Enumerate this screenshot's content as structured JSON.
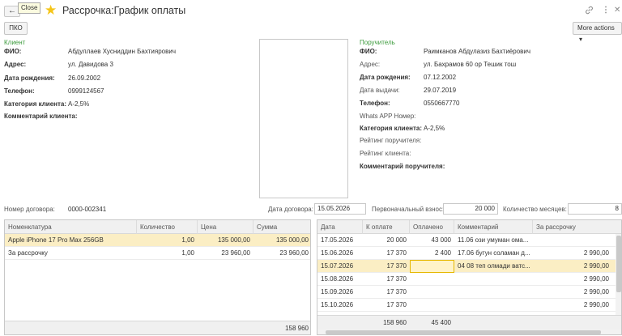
{
  "window": {
    "title": "Рассрочка:График оплаты",
    "tooltip": "Close"
  },
  "toolbar": {
    "pko_label": "ПКО",
    "more_actions_label": "More actions",
    "more_actions_arrow": "▾"
  },
  "client": {
    "section_label": "Клиент",
    "fio_label": "ФИО:",
    "fio": "Абдуллаев Хусниддин Бахтиярович",
    "address_label": "Адрес:",
    "address": "ул. Давидова 3",
    "birth_label": "Дата рождения:",
    "birth": "26.09.2002",
    "phone_label": "Телефон:",
    "phone": "0999124567",
    "category_label": "Категория клиента:",
    "category": "А-2,5%",
    "comment_label": "Комментарий клиента:"
  },
  "guarantor": {
    "section_label": "Поручитель",
    "fio_label": "ФИО:",
    "fio": "Раимканов Абдулазиз Бахтиёрович",
    "address_label": "Адрес:",
    "address": "ул. Бахрамов 60 ор Тешик тош",
    "birth_label": "Дата рождения:",
    "birth": "07.12.2002",
    "issue_label": "Дата выдачи:",
    "issue": "29.07.2019",
    "phone_label": "Телефон:",
    "phone": "0550667770",
    "whatsapp_label": "Whats APP Номер:",
    "category_label": "Категория клиента:",
    "category": "А-2,5%",
    "rating_guarantor_label": "Рейтинг поручителя:",
    "rating_client_label": "Рейтинг клиента:",
    "comment_label": "Комментарий поручителя:"
  },
  "contract": {
    "number_label": "Номер договора:",
    "number": "0000-002341",
    "date_label": "Дата договора:",
    "date": "15.05.2026",
    "initial_label": "Первоначальный взнос:",
    "initial": "20 000",
    "months_label": "Количество месяцев:",
    "months": "8"
  },
  "goods_table": {
    "columns": [
      "Номенклатура",
      "Количество",
      "Цена",
      "Сумма"
    ],
    "rows": [
      {
        "name": "Apple iPhone 17 Pro Max 256GB",
        "qty": "1,00",
        "price": "135 000,00",
        "sum": "135 000,00"
      },
      {
        "name": "За рассрочку",
        "qty": "1,00",
        "price": "23 960,00",
        "sum": "23 960,00"
      }
    ],
    "total_sum": "158 960"
  },
  "schedule_table": {
    "columns": [
      "Дата",
      "К оплате",
      "Оплачено",
      "Комментарий",
      "За рассрочку"
    ],
    "rows": [
      {
        "date": "17.05.2026",
        "due": "20 000",
        "paid": "43 000",
        "comment": "11.06 ози умуман ома...",
        "fee": ""
      },
      {
        "date": "15.06.2026",
        "due": "17 370",
        "paid": "2 400",
        "comment": "17.06 бугун соламан д...",
        "fee": "2 990,00"
      },
      {
        "date": "15.07.2026",
        "due": "17 370",
        "paid": "",
        "comment": "04 08 теп олмади ватс...",
        "fee": "2 990,00"
      },
      {
        "date": "15.08.2026",
        "due": "17 370",
        "paid": "",
        "comment": "",
        "fee": "2 990,00"
      },
      {
        "date": "15.09.2026",
        "due": "17 370",
        "paid": "",
        "comment": "",
        "fee": "2 990,00"
      },
      {
        "date": "15.10.2026",
        "due": "17 370",
        "paid": "",
        "comment": "",
        "fee": "2 990,00"
      }
    ],
    "total_due": "158 960",
    "total_paid": "45 400"
  },
  "icons": {
    "back": "back-arrow-icon",
    "favorite": "star-icon",
    "link": "link-icon",
    "menu": "kebab-menu-icon",
    "close": "close-icon"
  },
  "colors": {
    "section_label": "#3a9a3a",
    "selected_row": "#fbeec4",
    "favorite_star": "#f5c518"
  }
}
